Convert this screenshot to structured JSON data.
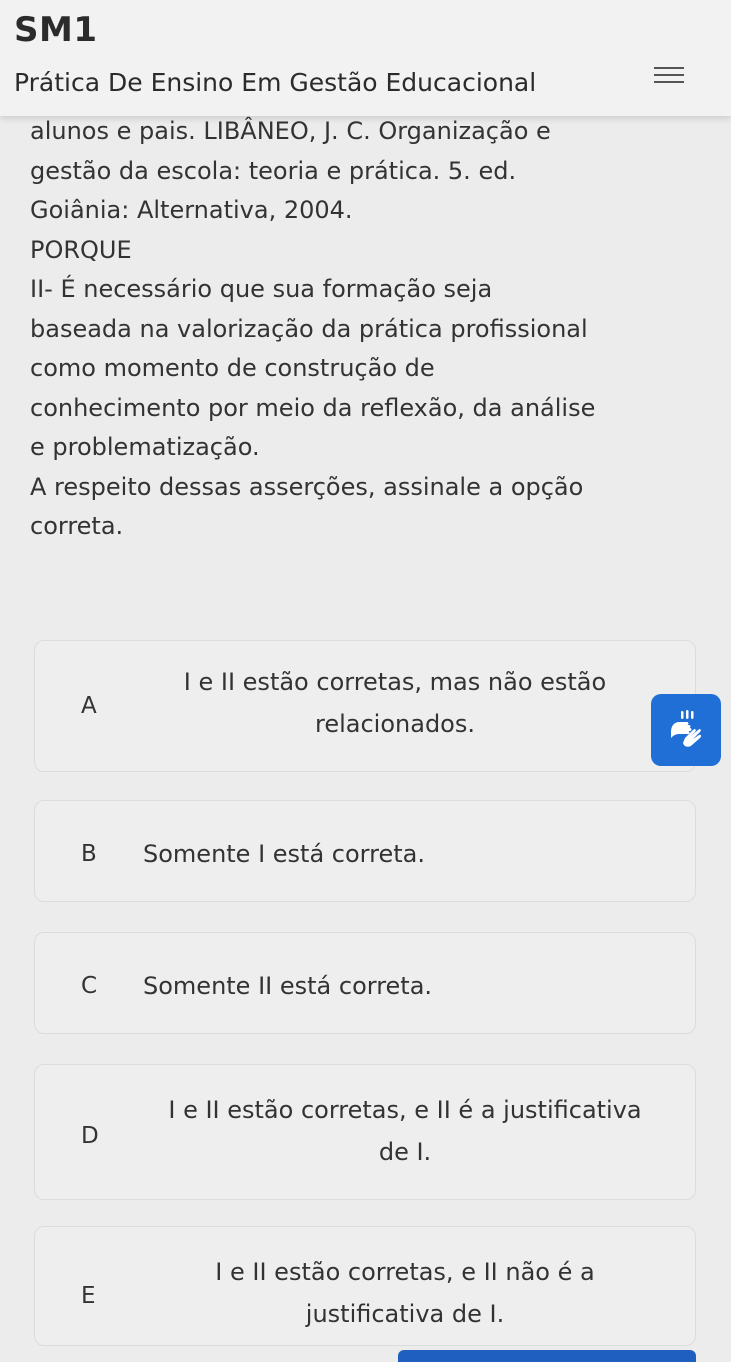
{
  "header": {
    "app_title": "SM1",
    "course_title": "Prática De Ensino Em Gestão Educacional"
  },
  "question": {
    "lines": [
      "alunos e pais. LIBÂNEO, J. C. Organização e",
      "gestão da escola: teoria e prática. 5. ed.",
      "Goiânia: Alternativa, 2004.",
      "PORQUE",
      "II-  É necessário que sua formação seja",
      "baseada na valorização da prática profissional",
      "como momento de construção de",
      "conhecimento por meio da reflexão, da análise",
      "e problematização.",
      "A respeito dessas asserções, assinale a opção",
      "correta."
    ]
  },
  "options": [
    {
      "letter": "A",
      "lines": [
        "I e II estão corretas, mas não estão",
        "relacionados."
      ]
    },
    {
      "letter": "B",
      "lines": [
        "Somente I está correta."
      ]
    },
    {
      "letter": "C",
      "lines": [
        "Somente II está correta."
      ]
    },
    {
      "letter": "D",
      "lines": [
        "I e II estão corretas, e II é a justificativa",
        "de I."
      ]
    },
    {
      "letter": "E",
      "lines": [
        "I e II estão corretas, e II não é a",
        "justificativa de I."
      ]
    }
  ],
  "icons": {
    "menu": "hamburger-menu-icon",
    "accessibility": "sign-language-hands-icon"
  },
  "colors": {
    "accent": "#1f6fd6",
    "background": "#ececec"
  }
}
